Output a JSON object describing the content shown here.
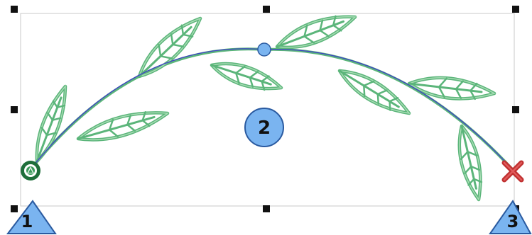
{
  "colors": {
    "frame": "#c8c8c8",
    "handle": "#111111",
    "curve": "#4040c8",
    "leaf_fill": "#a8dcb4",
    "leaf_stroke": "#5bb57a",
    "control_point": "#7ab4f0",
    "start_marker": "#1e6e3a",
    "end_marker": "#c03030",
    "callout_fill": "#7ab4f0",
    "callout_stroke": "#2a5aa0",
    "callout_text": "#111111"
  },
  "icons": {
    "start": "start-point-icon",
    "end": "end-point-icon",
    "control": "control-point-icon"
  },
  "callouts": {
    "one": "1",
    "two": "2",
    "three": "3"
  }
}
